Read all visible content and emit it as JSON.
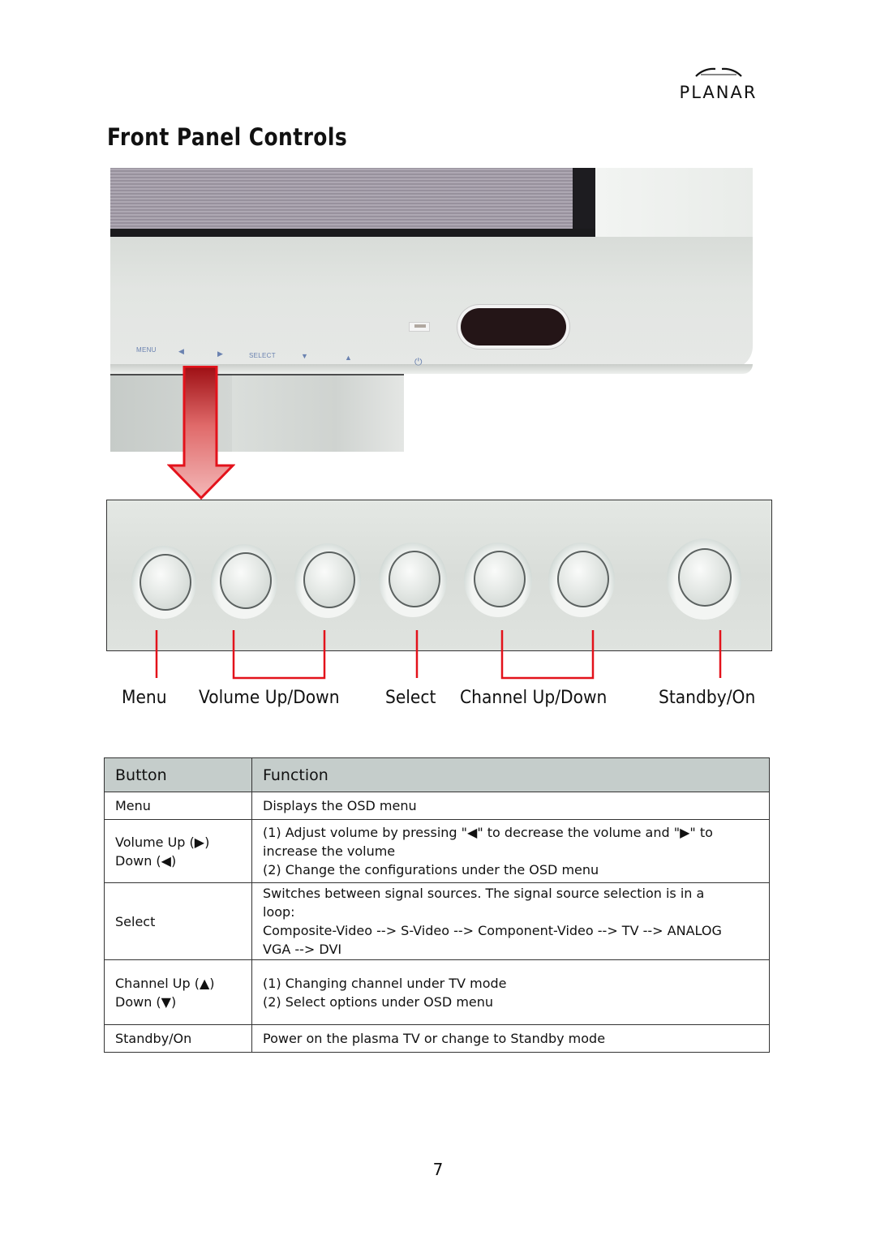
{
  "header": {
    "brand": "PLANAR",
    "brand_icon": "planar-arc-logo-icon"
  },
  "page_title": "Front Panel Controls",
  "tv_photo": {
    "panel_labels": {
      "menu": "MENU",
      "left": "◀",
      "right": "▶",
      "select": "SELECT",
      "down": "▼",
      "up": "▲",
      "power": "⏻"
    },
    "icons": [
      "power-indicator-led-icon",
      "ir-sensor-window-icon",
      "down-arrow-pointer-icon"
    ]
  },
  "button_panel": {
    "button_count": 7,
    "callout_color": "#e3121b"
  },
  "callouts": [
    {
      "label": "Menu"
    },
    {
      "label": "Volume Up/Down"
    },
    {
      "label": "Select"
    },
    {
      "label": "Channel Up/Down"
    },
    {
      "label": "Standby/On"
    }
  ],
  "table": {
    "headers": {
      "button": "Button",
      "function": "Function"
    },
    "header_bg": "#c5cdcb",
    "rows": [
      {
        "button": [
          "Menu"
        ],
        "function": [
          "Displays the OSD menu"
        ]
      },
      {
        "button": [
          "Volume Up (▶)",
          "Down (◀)"
        ],
        "function": [
          "(1) Adjust volume by pressing \"◀\" to decrease the volume and \"▶\" to",
          "increase the volume",
          "(2) Change the configurations under the OSD menu"
        ]
      },
      {
        "button": [
          "Select"
        ],
        "function": [
          "Switches between signal sources. The signal source selection is in a",
          "loop:",
          "Composite-Video --> S-Video --> Component-Video --> TV --> ANALOG",
          "VGA --> DVI"
        ]
      },
      {
        "button": [
          "Channel Up (▲)",
          "Down (▼)"
        ],
        "function": [
          "(1) Changing channel under TV mode",
          "(2) Select options under OSD menu"
        ]
      },
      {
        "button": [
          "Standby/On"
        ],
        "function": [
          "Power on the plasma TV or change to Standby mode"
        ]
      }
    ]
  },
  "page_number": "7"
}
